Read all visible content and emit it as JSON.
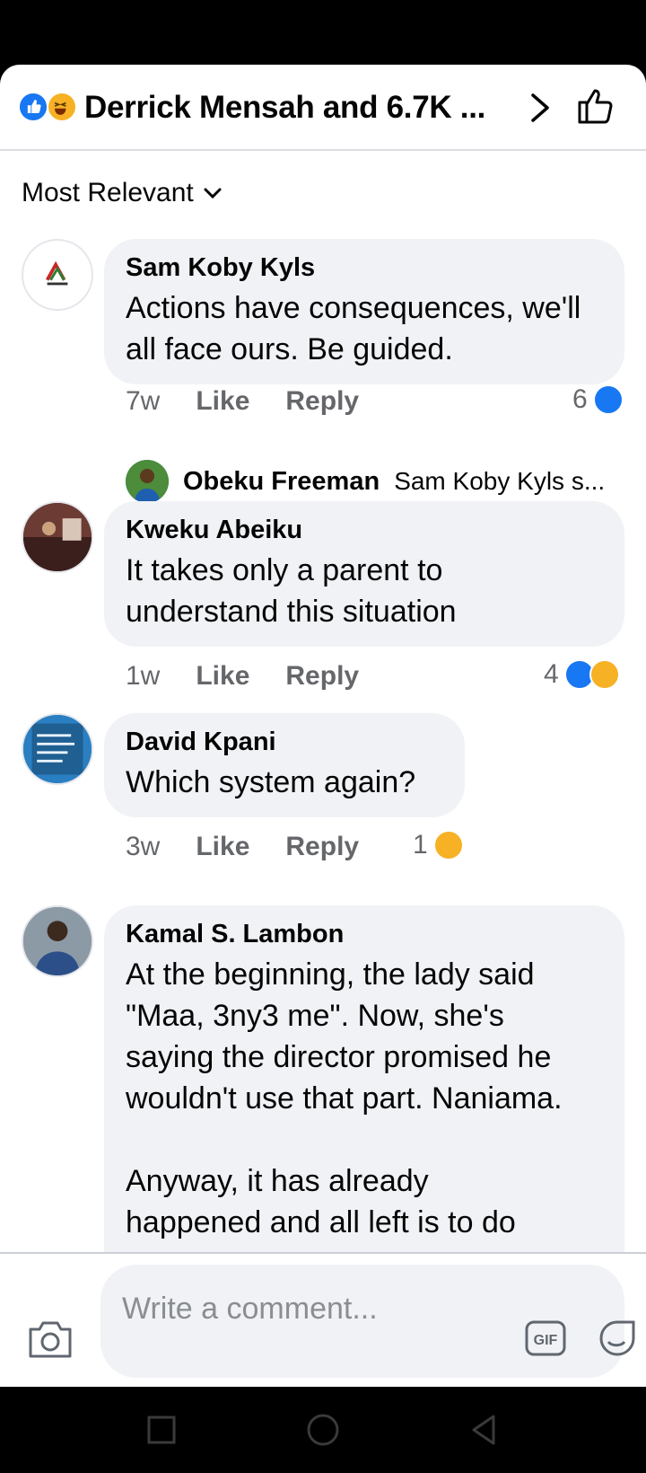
{
  "header": {
    "title": "Derrick Mensah and 6.7K ...",
    "reaction_icons": [
      "like-icon",
      "haha-icon"
    ]
  },
  "sort": {
    "label": "Most Relevant"
  },
  "comments": [
    {
      "name": "Sam Koby Kyls",
      "text": "Actions have consequences, we'll all face ours. Be guided.",
      "time": "7w",
      "like_label": "Like",
      "reply_label": "Reply",
      "reaction_count": "6",
      "reply_preview": {
        "name": "Obeku Freeman",
        "text": "Sam Koby Kyls s..."
      }
    },
    {
      "name": "Kweku Abeiku",
      "text": "It takes only a parent to understand this situation",
      "time": "1w",
      "like_label": "Like",
      "reply_label": "Reply",
      "reaction_count": "4"
    },
    {
      "name": "David Kpani",
      "text": "Which system again?",
      "time": "3w",
      "like_label": "Like",
      "reply_label": "Reply",
      "reaction_count": "1"
    },
    {
      "name": "Kamal S. Lambon",
      "text_lines": [
        "At the beginning, the lady said",
        "\"Maa, 3ny3 me\". Now, she's",
        "saying the director promised he",
        "wouldn't use that part. Naniama.",
        "",
        "Anyway, it has already",
        "happened and all left is to do"
      ]
    }
  ],
  "composer": {
    "placeholder": "Write a comment..."
  },
  "colors": {
    "facebook_blue": "#1877f2",
    "haha_yellow": "#f7b125",
    "bubble_bg": "#f0f2f5",
    "meta_gray": "#65676b"
  }
}
